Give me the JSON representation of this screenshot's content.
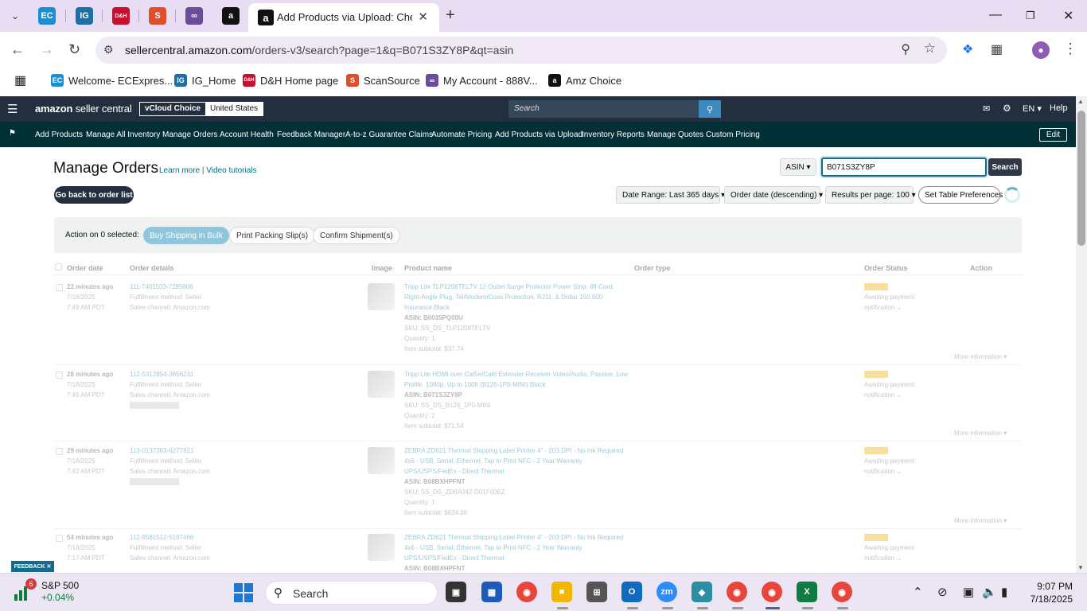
{
  "browser": {
    "tab_title": "Add Products via Upload: Chec",
    "url_domain": "sellercentral.amazon.com",
    "url_path": "/orders-v3/search?page=1&q=B071S3ZY8P&qt=asin",
    "pinned_tabs": [
      {
        "label": "EC",
        "color": "#1a8fd6"
      },
      {
        "label": "IG",
        "color": "#1d6fa8"
      },
      {
        "label": "D&H",
        "color": "#c8102e"
      },
      {
        "label": "S",
        "color": "#e04f2a"
      },
      {
        "label": "∞",
        "color": "#6b4c9a"
      },
      {
        "label": "a",
        "color": "#111111"
      }
    ],
    "bookmarks": [
      {
        "label": "Welcome- ECExpres...",
        "icon": "EC",
        "color": "#1a8fd6"
      },
      {
        "label": "IG_Home",
        "icon": "IG",
        "color": "#1d6fa8"
      },
      {
        "label": "D&H Home page",
        "icon": "D&H",
        "color": "#c8102e"
      },
      {
        "label": "ScanSource",
        "icon": "S",
        "color": "#e04f2a"
      },
      {
        "label": "My Account - 888V...",
        "icon": "∞",
        "color": "#6b4c9a"
      },
      {
        "label": "Amz Choice",
        "icon": "a",
        "color": "#111111"
      }
    ]
  },
  "header": {
    "logo_bold": "amazon",
    "logo_rest": " seller central",
    "account_name": "vCloud Choice",
    "region": "United States",
    "search_placeholder": "Search",
    "language": "EN",
    "help": "Help"
  },
  "nav": {
    "items": [
      "Add Products",
      "Manage All Inventory",
      "Manage Orders",
      "Account Health",
      "Feedback Manager",
      "A-to-z Guarantee Claims",
      "Automate Pricing",
      "Add Products via Upload",
      "Inventory Reports",
      "Manage Quotes",
      "Custom Pricing"
    ],
    "edit": "Edit"
  },
  "page": {
    "title": "Manage Orders",
    "learn_more": "Learn more",
    "separator": " | ",
    "video_tutorials": "Video tutorials",
    "search_type": "ASIN",
    "search_value": "B071S3ZY8P",
    "search_button": "Search",
    "back_button": "Go back to order list",
    "filters": {
      "date_range": "Date Range: Last 365 days",
      "sort": "Order date (descending)",
      "per_page": "Results per page: 100",
      "table_prefs": "Set Table Preferences"
    },
    "action_bar": {
      "label": "Action on 0 selected:",
      "buy_shipping": "Buy Shipping in Bulk",
      "print_slips": "Print Packing Slip(s)",
      "confirm": "Confirm Shipment(s)"
    },
    "columns": [
      "Order date",
      "Order details",
      "Image",
      "Product name",
      "Order type",
      "Order Status",
      "Action"
    ]
  },
  "orders": [
    {
      "age": "22 minutes ago",
      "date": "7/18/2025",
      "time": "7:49 AM PDT",
      "order_id": "111-7401503-7285806",
      "fulfillment": "Fulfillment method: Seller",
      "channel": "Sales channel: Amazon.com",
      "has_tag": false,
      "product_line1": "Tripp Lite TLP1208TELTV 12 Outlet Surge Protector Power Strip, 8ft Cord,",
      "product_line2": "Right-Angle Plug, Tel/Modem/Coax Protection, RJ11, & Dollar 150,000",
      "product_line3": "Insurance,Black",
      "asin": "ASIN: B0035PQ00U",
      "sku": "SKU: SS_DS_TLP1208TELTV",
      "qty": "Quantity: 1",
      "subtotal": "Item subtotal: $37.74",
      "status": "Awaiting payment",
      "status2": "notification",
      "more": "More information"
    },
    {
      "age": "28 minutes ago",
      "date": "7/18/2025",
      "time": "7:45 AM PDT",
      "order_id": "112-5312854-3656231",
      "fulfillment": "Fulfillment method: Seller",
      "channel": "Sales channel: Amazon.com",
      "has_tag": true,
      "product_line1": "Tripp Lite HDMI over Cat5e/Cat6 Extender Receiver Video/Audio, Passive, Low",
      "product_line2": "Profile, 1080p, Up to 100ft (B126-1P0-MINI) Black",
      "product_line3": "",
      "asin": "ASIN: B071S3ZY8P",
      "sku": "SKU: SS_DS_B126_1P0-MINI",
      "qty": "Quantity: 2",
      "subtotal": "Item subtotal: $71.54",
      "status": "Awaiting payment",
      "status2": "notification",
      "more": "More information"
    },
    {
      "age": "29 minutes ago",
      "date": "7/18/2025",
      "time": "7:42 AM PDT",
      "order_id": "113-0137363-6277821",
      "fulfillment": "Fulfillment method: Seller",
      "channel": "Sales channel: Amazon.com",
      "has_tag": true,
      "product_line1": "ZEBRA ZD621 Thermal Shipping Label Printer 4\" - 203 DPI - No Ink Required",
      "product_line2": "4x6 - USB, Serial, Ethernet, Tap to Print NFC - 2 Year Warranty",
      "product_line3": "UPS/USPS/FedEx - Direct Thermal",
      "asin": "ASIN: B08BXHPFNT",
      "sku": "SKU: SS_DS_ZD6A042-D01F00EZ",
      "qty": "Quantity: 1",
      "subtotal": "Item subtotal: $634.00",
      "status": "Awaiting payment",
      "status2": "notification",
      "more": "More information"
    },
    {
      "age": "54 minutes ago",
      "date": "7/18/2025",
      "time": "7:17 AM PDT",
      "order_id": "112-8581512-5187466",
      "fulfillment": "Fulfillment method: Seller",
      "channel": "Sales channel: Amazon.com",
      "has_tag": false,
      "product_line1": "ZEBRA ZD621 Thermal Shipping Label Printer 4\" - 203 DPI - No Ink Required",
      "product_line2": "4x6 - USB, Serial, Ethernet, Tap to Print NFC - 2 Year Warranty",
      "product_line3": "UPS/USPS/FedEx - Direct Thermal",
      "asin": "ASIN: B08BXHPFNT",
      "sku": "",
      "qty": "",
      "subtotal": "",
      "status": "Awaiting payment",
      "status2": "notification",
      "more": ""
    }
  ],
  "feedback": "FEEDBACK",
  "taskbar": {
    "ticker_badge": "6",
    "ticker_name": "S&P 500",
    "ticker_change": "+0.04%",
    "search": "Search",
    "time": "9:07 PM",
    "date": "7/18/2025"
  },
  "colors": {
    "amazon_dark": "#232f3e",
    "nav_teal": "#002f36",
    "link": "#007185",
    "browser_chrome": "#e9ddf3"
  }
}
